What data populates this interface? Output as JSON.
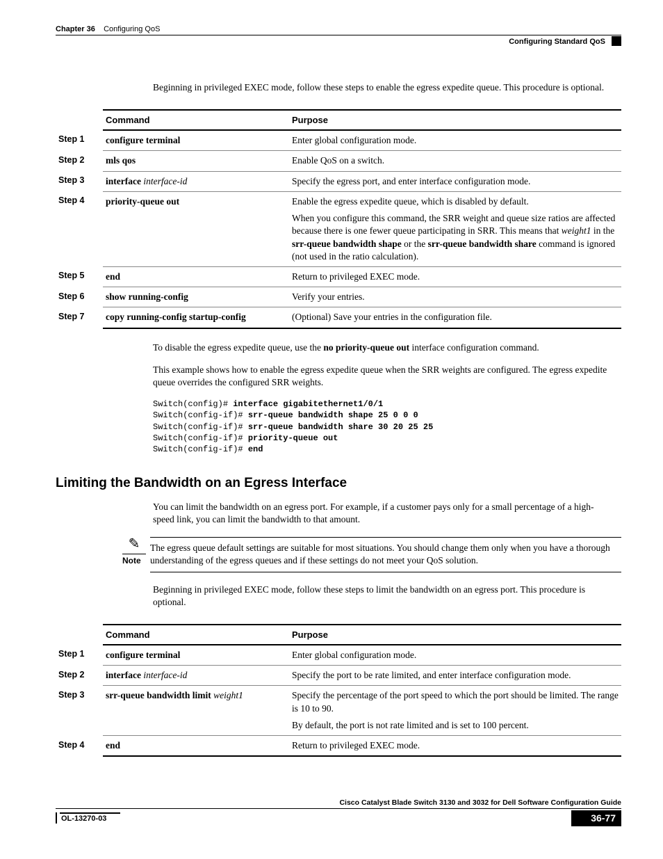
{
  "header": {
    "chapter_prefix": "Chapter 36",
    "chapter_title": "Configuring QoS",
    "section": "Configuring Standard QoS"
  },
  "intro1": "Beginning in privileged EXEC mode, follow these steps to enable the egress expedite queue. This procedure is optional.",
  "table1_headers": {
    "command": "Command",
    "purpose": "Purpose"
  },
  "table1": [
    {
      "step": "Step 1",
      "cmd_html": "<b>configure terminal</b>",
      "purpose_html": "Enter global configuration mode."
    },
    {
      "step": "Step 2",
      "cmd_html": "<b>mls qos</b>",
      "purpose_html": "Enable QoS on a switch."
    },
    {
      "step": "Step 3",
      "cmd_html": "<b>interface</b> <i>interface-id</i>",
      "purpose_html": "Specify the egress port, and enter interface configuration mode."
    },
    {
      "step": "Step 4",
      "cmd_html": "<b>priority-queue out</b>",
      "purpose_html": "<p>Enable the egress expedite queue, which is disabled by default.</p><p>When you configure this command, the SRR weight and queue size ratios are affected because there is one fewer queue participating in SRR. This means that <i>weight1</i> in the <b>srr-queue bandwidth shape</b> or the <b>srr-queue bandwidth share</b> command is ignored (not used in the ratio calculation).</p>"
    },
    {
      "step": "Step 5",
      "cmd_html": "<b>end</b>",
      "purpose_html": "Return to privileged EXEC mode."
    },
    {
      "step": "Step 6",
      "cmd_html": "<b>show running-config</b>",
      "purpose_html": "Verify your entries."
    },
    {
      "step": "Step 7",
      "cmd_html": "<b>copy running-config startup-config</b>",
      "purpose_html": "(Optional) Save your entries in the configuration file."
    }
  ],
  "after_table1_p1_html": "To disable the egress expedite queue, use the <b>no priority-queue out</b> interface configuration command.",
  "after_table1_p2": "This example shows how to enable the egress expedite queue when the SRR weights are configured. The egress expedite queue overrides the configured SRR weights.",
  "cli_html": "Switch(config)# <b>interface gigabitethernet1/0/1</b>\nSwitch(config-if)# <b>srr-queue bandwidth shape 25 0 0 0</b>\nSwitch(config-if)# <b>srr-queue bandwidth share 30 20 25 25</b>\nSwitch(config-if)# <b>priority-queue out</b>\nSwitch(config-if)# <b>end</b>",
  "section2_title": "Limiting the Bandwidth on an Egress Interface",
  "section2_intro": "You can limit the bandwidth on an egress port. For example, if a customer pays only for a small percentage of a high-speed link, you can limit the bandwidth to that amount.",
  "note_label": "Note",
  "note_text": "The egress queue default settings are suitable for most situations. You should change them only when you have a thorough understanding of the egress queues and if these settings do not meet your QoS solution.",
  "section2_intro2": "Beginning in privileged EXEC mode, follow these steps to limit the bandwidth on an egress port. This procedure is optional.",
  "table2": [
    {
      "step": "Step 1",
      "cmd_html": "<b>configure terminal</b>",
      "purpose_html": "Enter global configuration mode."
    },
    {
      "step": "Step 2",
      "cmd_html": "<b>interface</b> <i>interface-id</i>",
      "purpose_html": "Specify the port to be rate limited, and enter interface configuration mode."
    },
    {
      "step": "Step 3",
      "cmd_html": "<b>srr-queue bandwidth limit</b> <i>weight1</i>",
      "purpose_html": "<p>Specify the percentage of the port speed to which the port should be limited. The range is 10 to 90.</p><p>By default, the port is not rate limited and is set to 100 percent.</p>"
    },
    {
      "step": "Step 4",
      "cmd_html": "<b>end</b>",
      "purpose_html": "Return to privileged EXEC mode."
    }
  ],
  "footer": {
    "guide": "Cisco Catalyst Blade Switch 3130 and 3032 for Dell Software Configuration Guide",
    "doc_id": "OL-13270-03",
    "page": "36-77"
  }
}
